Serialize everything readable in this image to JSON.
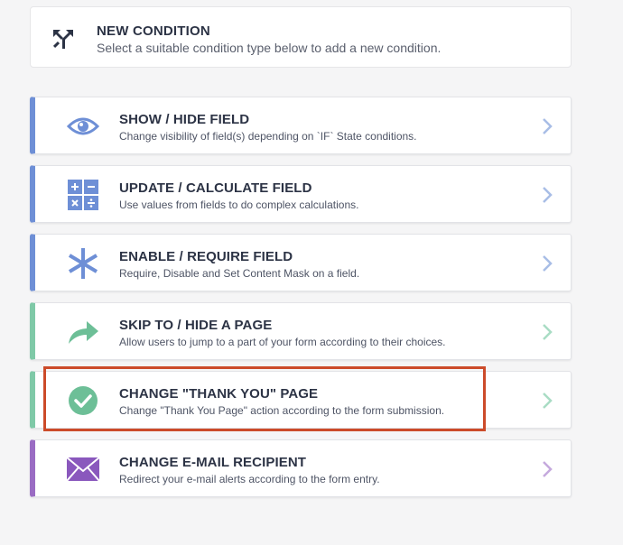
{
  "header": {
    "title": "NEW CONDITION",
    "subtitle": "Select a suitable condition type below to add a new condition.",
    "icon": "condition-icon"
  },
  "conditions": [
    {
      "title": "SHOW / HIDE FIELD",
      "subtitle": "Change visibility of field(s) depending on `IF` State conditions.",
      "icon": "eye-icon",
      "accent": "#6e8fd6",
      "chevron": "#a8bde6"
    },
    {
      "title": "UPDATE / CALCULATE FIELD",
      "subtitle": "Use values from fields to do complex calculations.",
      "icon": "calculator-icon",
      "accent": "#6e8fd6",
      "chevron": "#a8bde6"
    },
    {
      "title": "ENABLE / REQUIRE FIELD",
      "subtitle": "Require, Disable and Set Content Mask on a field.",
      "icon": "asterisk-icon",
      "accent": "#6e8fd6",
      "chevron": "#a8bde6"
    },
    {
      "title": "SKIP TO / HIDE A PAGE",
      "subtitle": "Allow users to jump to a part of your form according to their choices.",
      "icon": "share-arrow-icon",
      "accent": "#7fc9a7",
      "chevron": "#a9dcc4"
    },
    {
      "title": "CHANGE \"THANK YOU\" PAGE",
      "subtitle": "Change \"Thank You Page\" action according to the form submission.",
      "icon": "check-circle-icon",
      "accent": "#7fc9a7",
      "chevron": "#a9dcc4"
    },
    {
      "title": "CHANGE E-MAIL RECIPIENT",
      "subtitle": "Redirect your e-mail alerts according to the form entry.",
      "icon": "envelope-icon",
      "accent": "#9a6cc3",
      "chevron": "#c5a9dd"
    }
  ],
  "colors": {
    "highlight": "#cc4b2a",
    "blue_icon": "#6e8fd6",
    "green_icon": "#6dbf97",
    "purple_icon": "#8a58bd"
  }
}
